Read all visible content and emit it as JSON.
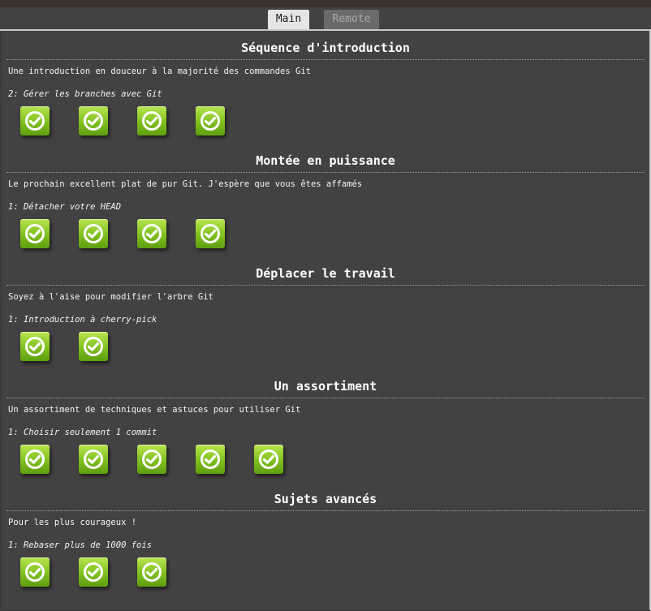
{
  "tabs": [
    {
      "label": "Main",
      "active": true
    },
    {
      "label": "Remote",
      "active": false
    }
  ],
  "sections": [
    {
      "title": "Séquence d'introduction",
      "description": "Une introduction en douceur à la majorité des commandes Git",
      "current_level": "2: Gérer les branches avec Git",
      "levels": [
        {
          "status": "completed",
          "icon": "checkmark-icon"
        },
        {
          "status": "completed",
          "icon": "checkmark-icon"
        },
        {
          "status": "completed",
          "icon": "checkmark-icon"
        },
        {
          "status": "completed",
          "icon": "checkmark-icon"
        }
      ]
    },
    {
      "title": "Montée en puissance",
      "description": "Le prochain excellent plat de pur Git. J'espère que vous êtes affamés",
      "current_level": "1: Détacher votre HEAD",
      "levels": [
        {
          "status": "completed",
          "icon": "checkmark-icon"
        },
        {
          "status": "completed",
          "icon": "checkmark-icon"
        },
        {
          "status": "completed",
          "icon": "checkmark-icon"
        },
        {
          "status": "completed",
          "icon": "checkmark-icon"
        }
      ]
    },
    {
      "title": "Déplacer le travail",
      "description": "Soyez à l'aise pour modifier l'arbre Git",
      "current_level": "1: Introduction à cherry-pick",
      "levels": [
        {
          "status": "completed",
          "icon": "checkmark-icon"
        },
        {
          "status": "completed",
          "icon": "checkmark-icon"
        }
      ]
    },
    {
      "title": "Un assortiment",
      "description": "Un assortiment de techniques et astuces pour utiliser Git",
      "current_level": "1: Choisir seulement 1 commit",
      "levels": [
        {
          "status": "completed",
          "icon": "checkmark-icon"
        },
        {
          "status": "completed",
          "icon": "checkmark-icon"
        },
        {
          "status": "completed",
          "icon": "checkmark-icon"
        },
        {
          "status": "completed",
          "icon": "checkmark-icon"
        },
        {
          "status": "completed",
          "icon": "checkmark-icon"
        }
      ]
    },
    {
      "title": "Sujets avancés",
      "description": "Pour les plus courageux !",
      "current_level": "1: Rebaser plus de 1000 fois",
      "levels": [
        {
          "status": "completed",
          "icon": "checkmark-icon"
        },
        {
          "status": "completed",
          "icon": "checkmark-icon"
        },
        {
          "status": "completed",
          "icon": "checkmark-icon"
        }
      ]
    }
  ],
  "colors": {
    "background": "#424242",
    "level_complete": "#7fbf1f",
    "active_tab": "#e6e6e6",
    "inactive_tab": "#6a6a6a"
  }
}
